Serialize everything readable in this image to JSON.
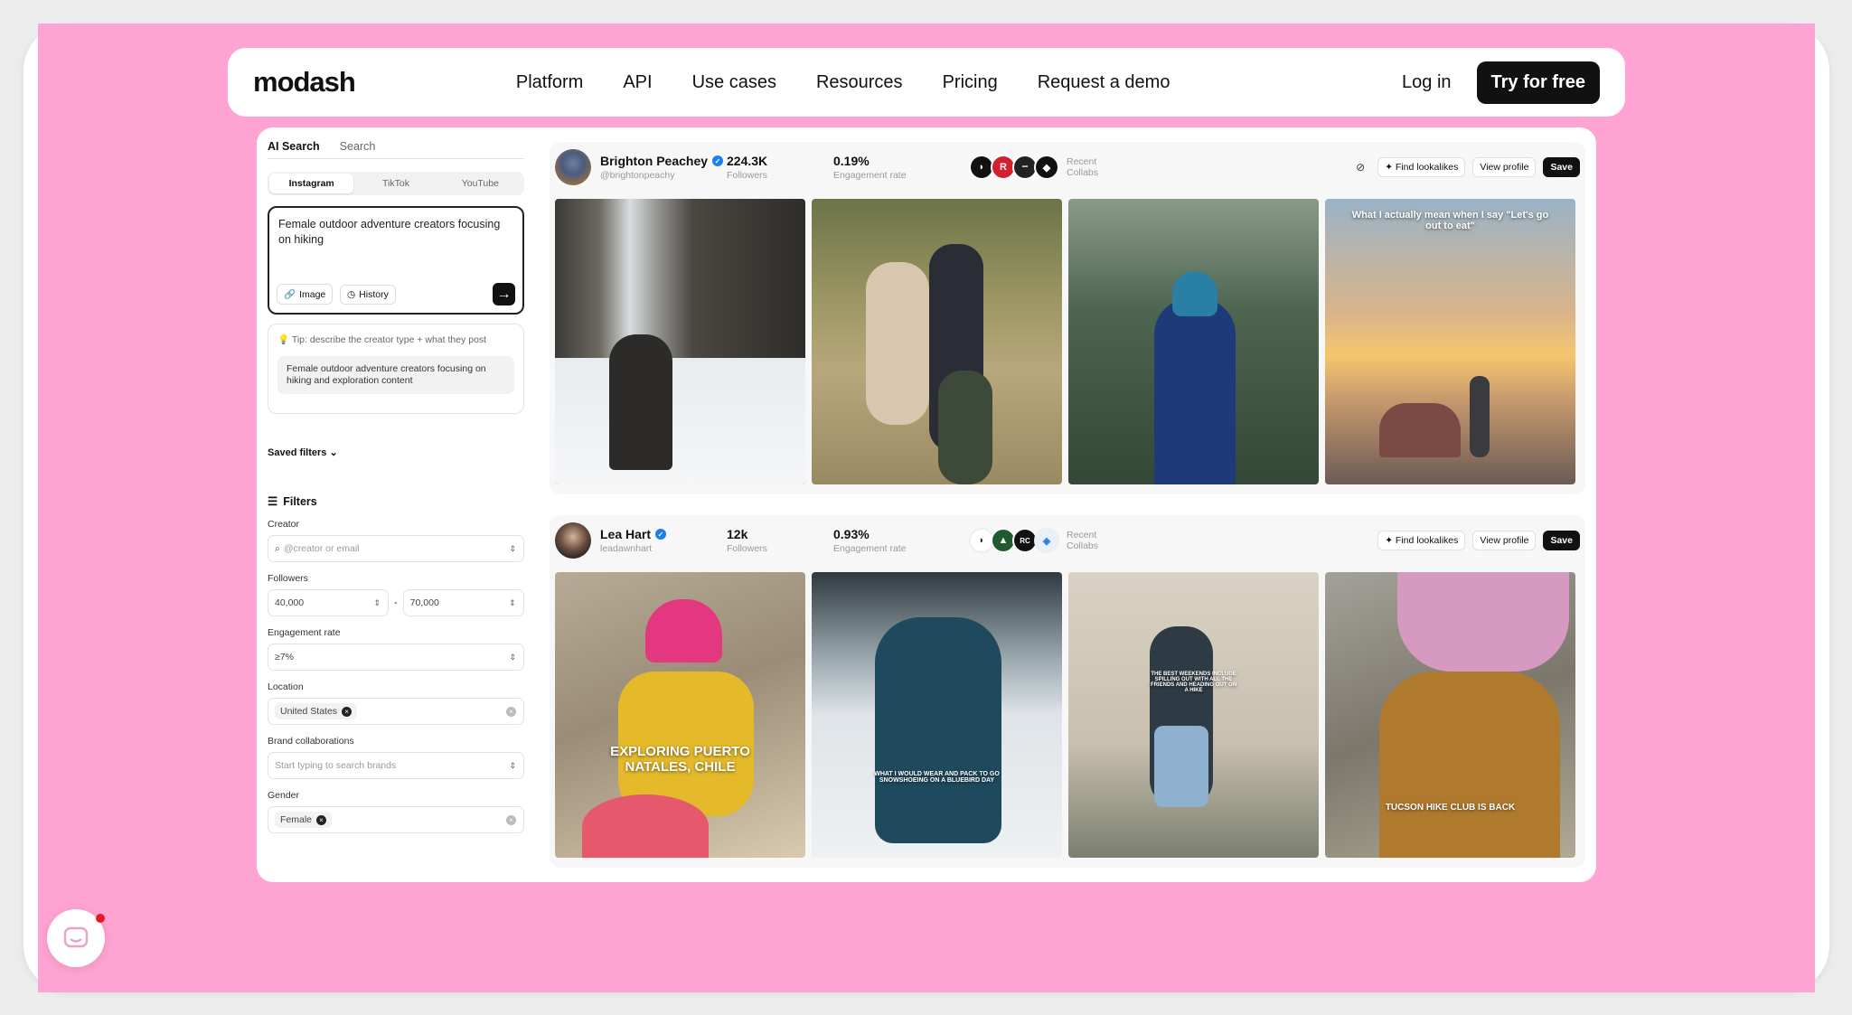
{
  "nav": {
    "logo": "modash",
    "links": [
      "Platform",
      "API",
      "Use cases",
      "Resources",
      "Pricing",
      "Request a demo"
    ],
    "login": "Log in",
    "cta": "Try for free"
  },
  "search": {
    "tabs": [
      "AI Search",
      "Search"
    ],
    "platforms": [
      "Instagram",
      "TikTok",
      "YouTube"
    ],
    "prompt": "Female outdoor adventure creators focusing on hiking",
    "image_btn": "Image",
    "history_btn": "History",
    "tip": "Tip: describe the creator type + what they post",
    "suggestion": "Female outdoor adventure creators focusing on hiking and exploration content",
    "saved_filters": "Saved filters"
  },
  "filters": {
    "title": "Filters",
    "creator_label": "Creator",
    "creator_placeholder": "@creator or email",
    "followers_label": "Followers",
    "followers_min": "40,000",
    "followers_sep": "-",
    "followers_max": "70,000",
    "engagement_label": "Engagement rate",
    "engagement_value": "≥7%",
    "location_label": "Location",
    "location_value": "United States",
    "brand_label": "Brand collaborations",
    "brand_placeholder": "Start typing to search brands",
    "gender_label": "Gender",
    "gender_value": "Female"
  },
  "actions": {
    "find": "Find lookalikes",
    "view": "View profile",
    "save": "Save"
  },
  "creators": [
    {
      "name": "Brighton Peachey",
      "handle": "@brightonpeachy",
      "followers": "224.3K",
      "followers_label": "Followers",
      "engagement": "0.19%",
      "engagement_label": "Engagement rate",
      "collab_label": "Recent Collabs",
      "captions": [
        "",
        "",
        "",
        "What I actually mean when I say \"Let's go out to eat\""
      ]
    },
    {
      "name": "Lea Hart",
      "handle": "leadawnhart",
      "followers": "12k",
      "followers_label": "Followers",
      "engagement": "0.93%",
      "engagement_label": "Engagement rate",
      "collab_label": "Recent Collabs",
      "captions": [
        "EXPLORING PUERTO NATALES, CHILE",
        "WHAT I WOULD WEAR AND PACK TO GO SNOWSHOEING ON A BLUEBIRD DAY",
        "THE BEST WEEKENDS INCLUDE SPILLING OUT WITH ALL THE FRIENDS AND HEADING OUT ON A HIKE",
        "TUCSON HIKE CLUB IS BACK"
      ]
    }
  ]
}
